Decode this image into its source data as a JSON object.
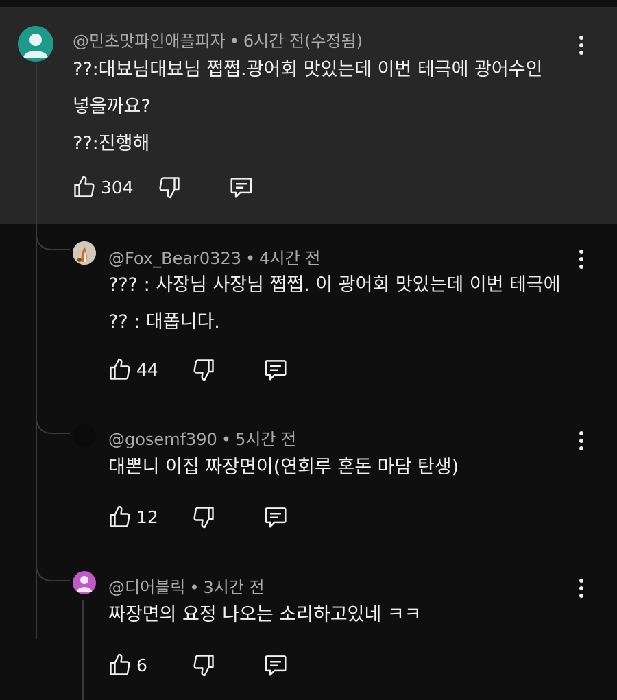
{
  "comments": [
    {
      "handle": "@민초맛파인애플피자",
      "time": "6시간 전(수정됨)",
      "lines": [
        "??:대뵤님대뵤님 쩝쩝.광어회 맛있는데 이번 테극에 광어수인",
        "넣을까요?",
        "??:진행해"
      ],
      "likes": "304",
      "avatar_color": "#1e9a8c"
    },
    {
      "handle": "@Fox_Bear0323",
      "time": "4시간 전",
      "lines": [
        "??? : 사장님 사장님 쩝쩝. 이 광어회 맛있는데 이번 테극에",
        "?? : 대폽니다."
      ],
      "likes": "44",
      "avatar_color": "#d9d4c8"
    },
    {
      "handle": "@gosemf390",
      "time": "5시간 전",
      "lines": [
        "대뽄니 이집 짜장면이(연회루 혼돈 마담 탄생)"
      ],
      "likes": "12",
      "avatar_color": "#0b0b0b"
    },
    {
      "handle": "@디어블릭",
      "time": "3시간 전",
      "lines": [
        "짜장면의 요정 나오는 소리하고있네 ㅋㅋ"
      ],
      "likes": "6",
      "avatar_color": "#c05ac6"
    }
  ],
  "separator": "•",
  "icons": {
    "like": "thumb-up-icon",
    "dislike": "thumb-down-icon",
    "reply": "reply-icon",
    "more": "more-vert-icon"
  }
}
